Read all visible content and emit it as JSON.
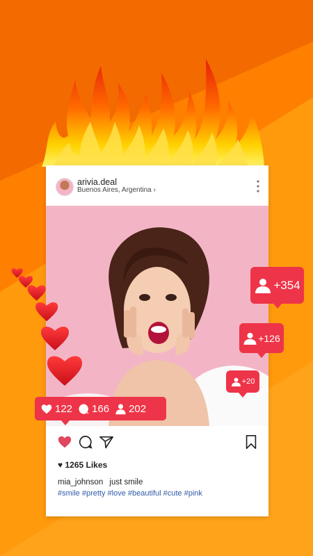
{
  "post": {
    "username": "arivia.deal",
    "location": "Buenos Aires, Argentina",
    "location_chevron": "›",
    "likes_text": "1265 Likes",
    "caption_user": "mia_johnson",
    "caption_text": "just smile",
    "hashtags": "#smile #pretty #love #beautiful #cute #pink"
  },
  "stats": {
    "likes": "122",
    "comments": "166",
    "followers": "202"
  },
  "follower_badges": [
    {
      "label": "+354"
    },
    {
      "label": "+126"
    },
    {
      "label": "+20"
    }
  ],
  "colors": {
    "background": "#ff8a00",
    "badge": "#ee3448",
    "like_heart": "#e0475e",
    "hashtag": "#2f5aa8"
  },
  "icons": [
    "flame-icon",
    "heart-icon",
    "comment-icon",
    "share-icon",
    "bookmark-icon",
    "more-icon",
    "person-icon"
  ]
}
